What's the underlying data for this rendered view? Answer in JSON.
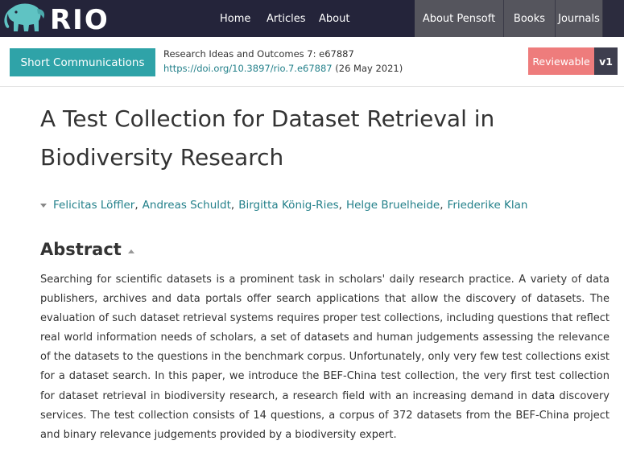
{
  "header": {
    "logo_text": "RIO",
    "nav": [
      {
        "label": "Home"
      },
      {
        "label": "Articles"
      },
      {
        "label": "About"
      }
    ],
    "right_nav": [
      {
        "label": "About Pensoft"
      },
      {
        "label": "Books"
      },
      {
        "label": "Journals"
      }
    ]
  },
  "article_bar": {
    "type_label": "Short Communications",
    "journal_line": "Research Ideas and Outcomes 7: e67887",
    "doi": "https://doi.org/10.3897/rio.7.e67887",
    "date": " (26 May 2021)",
    "reviewable_label": "Reviewable",
    "version_label": "v1"
  },
  "article": {
    "title": "A Test Collection for Dataset Retrieval in Biodiversity Research",
    "authors": [
      "Felicitas Löffler",
      "Andreas Schuldt",
      "Birgitta König-Ries",
      "Helge Bruelheide",
      "Friederike Klan"
    ],
    "abstract_heading": "Abstract",
    "abstract": "Searching for scientific datasets is a prominent task in scholars' daily research practice. A variety of data publishers, archives and data portals offer search applications that allow the discovery of datasets. The evaluation of such dataset retrieval systems requires proper test collections, including questions that reflect real world information needs of scholars, a set of datasets and human judgements assessing the relevance of the datasets to the questions in the benchmark corpus. Unfortunately, only very few test collections exist for a dataset search. In this paper, we introduce the BEF-China test collection, the very first test collection for dataset retrieval in biodiversity research, a research field with an increasing demand in data discovery services. The test collection consists of 14 questions, a corpus of 372 datasets from the BEF-China project and binary relevance judgements provided by a biodiversity expert."
  },
  "colors": {
    "topbar": "#24243a",
    "accent_teal": "#2fa3a8",
    "link": "#23808a",
    "reviewable": "#ee7c7c"
  },
  "icons": {
    "logo": "elephant-icon",
    "authors_toggle": "caret-down-icon",
    "abstract_toggle": "caret-up-icon"
  }
}
